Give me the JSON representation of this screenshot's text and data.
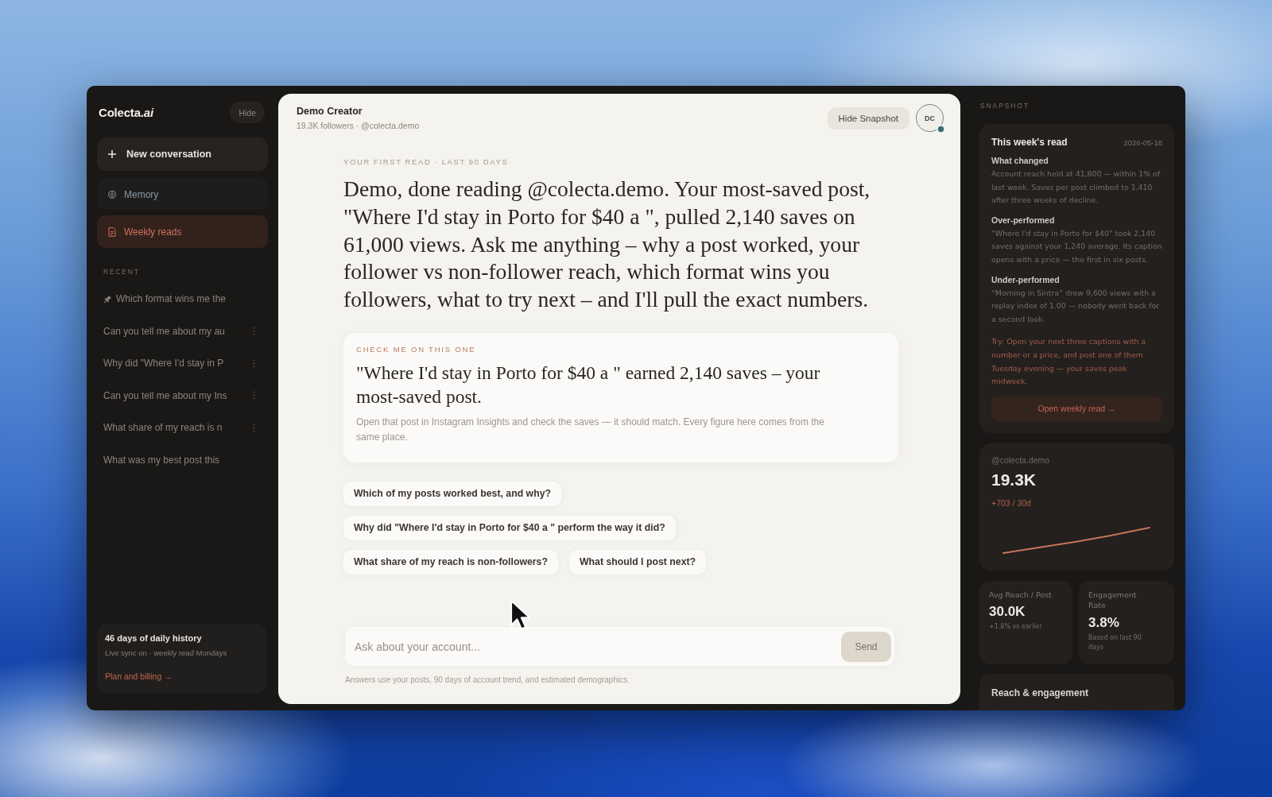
{
  "sidebar": {
    "logo": "Colecta.*ai*",
    "hide_button": "Hide",
    "new_conversation": "New conversation",
    "nav": [
      {
        "label": "Memory",
        "kind": "memory",
        "selected": false
      },
      {
        "label": "Weekly reads",
        "kind": "reads",
        "selected": true
      }
    ],
    "recent_heading": "RECENT",
    "recent": [
      {
        "title": "Which format wins me the",
        "pinned": true,
        "show_more": false
      },
      {
        "title": "Can you tell me about my au",
        "pinned": false,
        "show_more": true
      },
      {
        "title": "Why did \"Where I'd stay in P",
        "pinned": false,
        "show_more": true
      },
      {
        "title": "Can you tell me about my Ins",
        "pinned": false,
        "show_more": true
      },
      {
        "title": "What share of my reach is n",
        "pinned": false,
        "show_more": true
      },
      {
        "title": "What was my best post this",
        "pinned": false,
        "show_more": false
      }
    ],
    "footer": {
      "title": "46 days of daily history",
      "subtitle": "Live sync on · weekly read Mondays",
      "link": "Plan and billing →"
    }
  },
  "header": {
    "name": "Demo Creator",
    "meta": "19.3K followers · @colecta.demo",
    "hide_snapshot": "Hide Snapshot",
    "avatar": {
      "initials": "DC",
      "badge": true
    }
  },
  "chat": {
    "eyebrow": "YOUR FIRST READ · LAST 90 DAYS",
    "message": "Demo, done reading @colecta.demo. Your most-saved post, \"Where I'd stay in Porto for $40 a \", pulled 2,140 saves on 61,000 views. Ask me anything – why a post worked, your follower vs non-follower reach, which format wins you followers, what to try next – and I'll pull the exact numbers.",
    "check_card": {
      "eyebrow": "CHECK ME ON THIS ONE",
      "claim": "\"Where I'd stay in Porto for $40 a \" earned 2,140 saves – your most-saved post.",
      "note": "Open that post in Instagram Insights and check the saves — it should match. Every figure here comes from the same place."
    },
    "suggestions": [
      "Which of my posts worked best, and why?",
      "Why did \"Where I'd stay in Porto for $40 a \" perform the way it did?",
      "What share of my reach is non-followers?",
      "What should I post next?"
    ]
  },
  "composer": {
    "placeholder": "Ask about your account...",
    "send": {
      "label": "Send",
      "disabled": true
    },
    "disclaimer": "Answers use your posts, 90 days of account trend, and estimated demographics."
  },
  "snapshot": {
    "heading": "SNAPSHOT",
    "weekly": {
      "title": "This week's read",
      "date": "2026-05-18",
      "sections": [
        {
          "heading": "What changed",
          "body": "Account reach held at 41,800 — within 1% of last week. Saves per post climbed to 1,410 after three weeks of decline."
        },
        {
          "heading": "Over-performed",
          "body": "“Where I'd stay in Porto for $40” took 2,140 saves against your 1,240 average. Its caption opens with a price — the first in six posts."
        },
        {
          "heading": "Under-performed",
          "body": "“Morning in Sintra” drew 9,600 views with a replay index of 1.00 — nobody went back for a second look."
        }
      ],
      "tip": "Try: Open your next three captions with a number or a price, and post one of them Tuesday evening — your saves peak midweek.",
      "button": "Open weekly read →"
    },
    "followers": {
      "handle": "@colecta.demo",
      "value": "19.3K",
      "delta": "+703 / 30d"
    },
    "metrics": [
      {
        "label": "Avg Reach / Post",
        "value": "30.0K",
        "note": "+1.8% vs earlier"
      },
      {
        "label": "Engagement Rate",
        "value": "3.8%",
        "note": "Based on last 90 days"
      }
    ],
    "reach_title": "Reach & engagement"
  }
}
